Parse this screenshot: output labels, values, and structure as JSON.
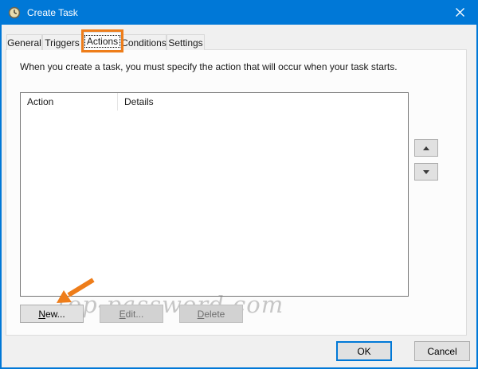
{
  "window": {
    "title": "Create Task",
    "icon": "task-scheduler-clock"
  },
  "tabs": [
    {
      "label": "General",
      "selected": false
    },
    {
      "label": "Triggers",
      "selected": false
    },
    {
      "label": "Actions",
      "selected": true
    },
    {
      "label": "Conditions",
      "selected": false
    },
    {
      "label": "Settings",
      "selected": false
    }
  ],
  "content": {
    "instruction": "When you create a task, you must specify the action that will occur when your task starts."
  },
  "actions_list": {
    "columns": [
      {
        "label": "Action"
      },
      {
        "label": "Details"
      }
    ],
    "rows": []
  },
  "action_buttons": {
    "new": {
      "key": "N",
      "rest": "ew...",
      "enabled": true
    },
    "edit": {
      "key": "E",
      "rest": "dit...",
      "enabled": false
    },
    "delete": {
      "key": "D",
      "rest": "elete",
      "enabled": false
    }
  },
  "dialog_buttons": {
    "ok": "OK",
    "cancel": "Cancel"
  },
  "annotations": {
    "watermark": "top-password.com",
    "highlight_color": "#ee7d1a"
  },
  "colors": {
    "titlebar": "#0078d7",
    "accent": "#0078d7",
    "dialog_bg": "#f0f0f0",
    "tab_page_bg": "#fcfcfc"
  }
}
